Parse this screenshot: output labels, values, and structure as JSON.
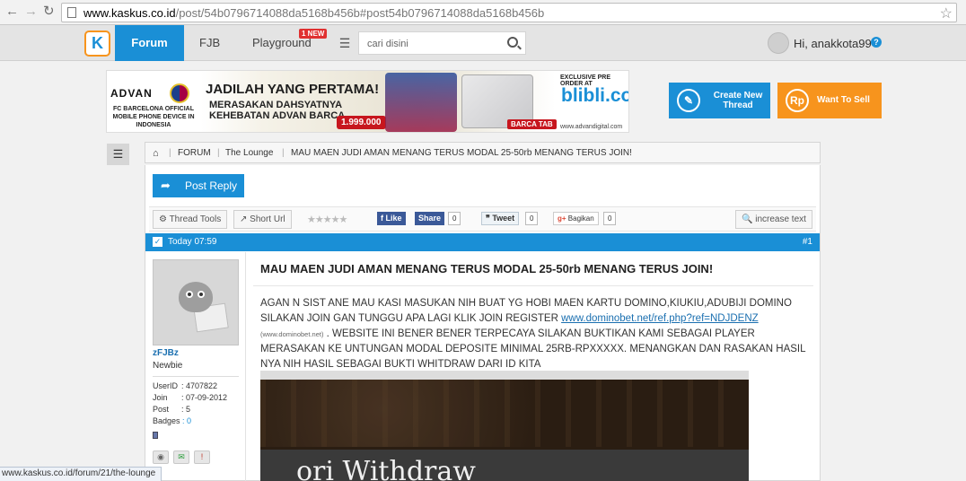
{
  "browser": {
    "url_host": "www.kaskus.co.id",
    "url_path": "/post/54b0796714088da5168b456b#post54b0796714088da5168b456b",
    "back_icon": "arrow-left-icon",
    "forward_icon": "arrow-right-icon",
    "reload_icon": "reload-icon",
    "bookmark_icon": "star-icon",
    "status_url": "www.kaskus.co.id/forum/21/the-lounge"
  },
  "topnav": {
    "forum": "Forum",
    "fjb": "FJB",
    "playground": "Playground",
    "new_badge": "1 NEW",
    "search_placeholder": "cari disini",
    "greeting": "Hi, anakkota99",
    "help": "?"
  },
  "banner": {
    "brand": "ADVAN",
    "official": "FC BARCELONA OFFICIAL MOBILE PHONE DEVICE IN INDONESIA",
    "headline": "JADILAH YANG PERTAMA!",
    "sub1": "MERASAKAN DAHSYATNYA",
    "sub2": "KEHEBATAN ADVAN BARCA",
    "price": "1.999.000",
    "barca_tab": "BARCA TAB",
    "preorder": "EXCLUSIVE PRE ORDER AT",
    "blibli": "blibli.com",
    "site": "www.advandigital.com"
  },
  "actions": {
    "create_thread": "Create New Thread",
    "want_to_sell": "Want To Sell",
    "rp": "Rp"
  },
  "breadcrumb": {
    "home_icon": "home-icon",
    "forum": "FORUM",
    "lounge": "The Lounge",
    "thread": "MAU MAEN JUDI AMAN MENANG TERUS MODAL 25-50rb MENANG TERUS JOIN!"
  },
  "toolbar": {
    "post_reply": "Post Reply",
    "thread_tools": "Thread Tools",
    "short_url": "Short Url",
    "like": "Like",
    "share": "Share",
    "fb_count": "0",
    "tweet": "Tweet",
    "tw_count": "0",
    "bagikan": "Bagikan",
    "gp_count": "0",
    "increase_text": "increase text",
    "rating_stars": 0
  },
  "post": {
    "time": "Today 07:59",
    "number": "#1",
    "title": "MAU MAEN JUDI AMAN MENANG TERUS MODAL 25-50rb MENANG TERUS JOIN!",
    "body_1": "AGAN N SIST ANE MAU KASI MASUKAN NIH BUAT YG HOBI MAEN KARTU DOMINO,KIUKIU,ADUBIJI DOMINO SILAKAN JOIN GAN TUNGGU APA LAGI KLIK JOIN REGISTER",
    "link": "www.dominobet.net/ref.php?ref=NDJDENZ",
    "link_small": "(www.dominobet.net)",
    "body_2": ". WEBSITE INI BENER BENER TERPECAYA SILAKAN BUKTIKAN KAMI SEBAGAI PLAYER MERASAKAN KE UNTUNGAN MODAL DEPOSITE MINIMAL 25RB-RPXXXXX. MENANGKAN DAN RASAKAN HASIL NYA NIH HASIL SEBAGAI BUKTI WHITDRAW DARI ID KITA",
    "image_caption": "ori Withdraw"
  },
  "author": {
    "username": "zFJBz",
    "rank": "Newbie",
    "userid_label": "UserID",
    "userid": ": 4707822",
    "join_label": "Join",
    "join": ": 07-09-2012",
    "post_label": "Post",
    "post": ": 5",
    "badges_label": "Badges",
    "badges": ": 0"
  },
  "colors": {
    "kaskus_blue": "#1a8fd6",
    "kaskus_orange": "#f7941d"
  }
}
